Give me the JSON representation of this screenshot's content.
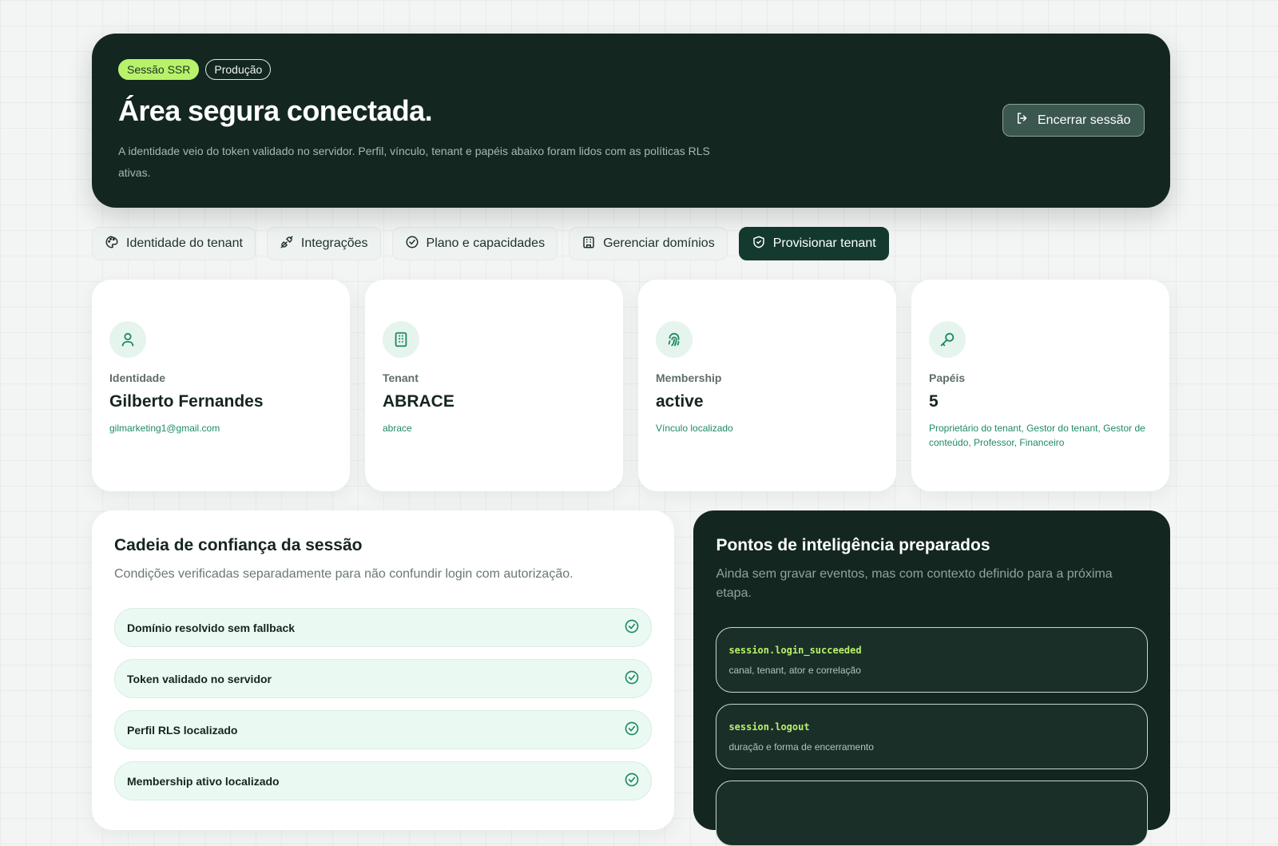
{
  "hero": {
    "badges": [
      "Sessão SSR",
      "Produção"
    ],
    "title": "Área segura conectada.",
    "description": "A identidade veio do token validado no servidor. Perfil, vínculo, tenant e papéis abaixo foram lidos com as políticas RLS ativas.",
    "logout_label": "Encerrar sessão"
  },
  "tabs": [
    {
      "label": "Identidade do tenant",
      "icon": "palette-icon"
    },
    {
      "label": "Integrações",
      "icon": "plug-icon"
    },
    {
      "label": "Plano e capacidades",
      "icon": "check-circle-icon"
    },
    {
      "label": "Gerenciar domínios",
      "icon": "building-icon"
    },
    {
      "label": "Provisionar tenant",
      "icon": "shield-check-icon",
      "active": true
    }
  ],
  "cards": [
    {
      "label": "Identidade",
      "value": "Gilberto Fernandes",
      "sub": "gilmarketing1@gmail.com",
      "icon": "user-icon"
    },
    {
      "label": "Tenant",
      "value": "ABRACE",
      "sub": "abrace",
      "icon": "building-icon"
    },
    {
      "label": "Membership",
      "value": "active",
      "sub": "Vínculo localizado",
      "icon": "fingerprint-icon"
    },
    {
      "label": "Papéis",
      "value": "5",
      "sub": "Proprietário do tenant, Gestor do tenant, Gestor de conteúdo, Professor, Financeiro",
      "icon": "key-icon"
    }
  ],
  "trust": {
    "title": "Cadeia de confiança da sessão",
    "description": "Condições verificadas separadamente para não confundir login com autorização.",
    "items": [
      "Domínio resolvido sem fallback",
      "Token validado no servidor",
      "Perfil RLS localizado",
      "Membership ativo localizado"
    ]
  },
  "intelligence": {
    "title": "Pontos de inteligência preparados",
    "description": "Ainda sem gravar eventos, mas com contexto definido para a próxima etapa.",
    "events": [
      {
        "code": "session.login_succeeded",
        "desc": "canal, tenant, ator e correlação"
      },
      {
        "code": "session.logout",
        "desc": "duração e forma de encerramento"
      }
    ]
  },
  "colors": {
    "accent_dark": "#132720",
    "accent_green": "#1f8a65",
    "lime": "#b8f26b"
  }
}
